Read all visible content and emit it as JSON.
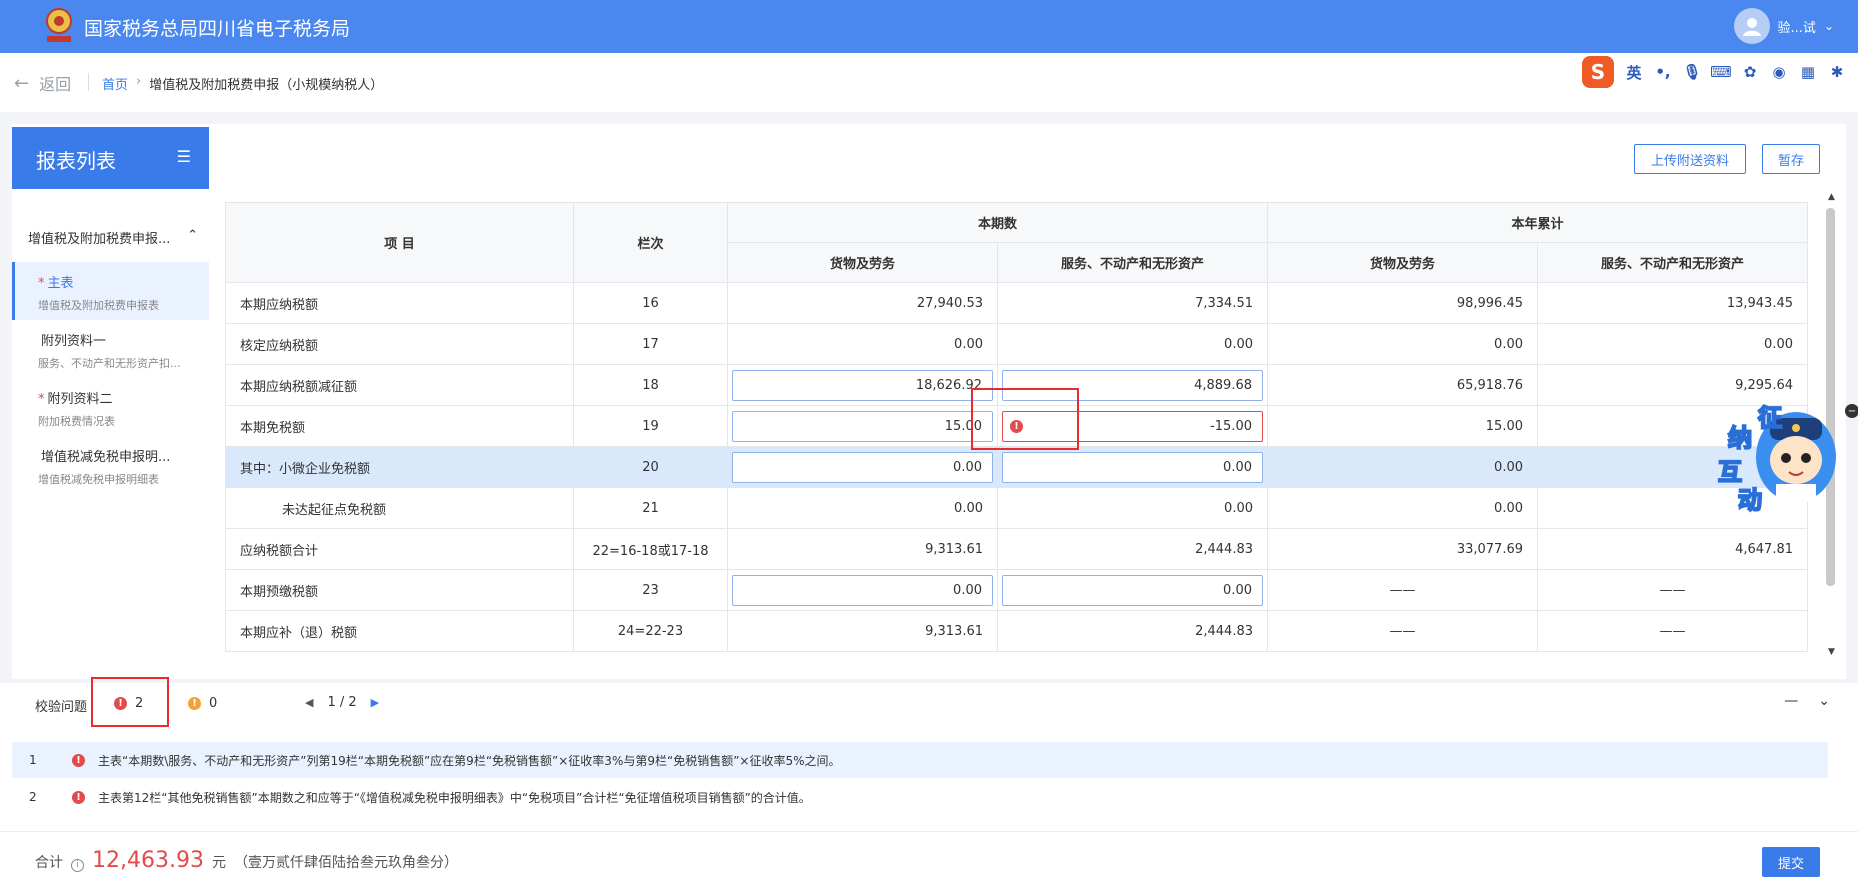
{
  "header": {
    "title": "国家税务总局四川省电子税务局",
    "user": "验...试"
  },
  "breadcrumb": {
    "back": "返回",
    "home": "首页",
    "sep": "›",
    "current": "增值税及附加税费申报（小规模纳税人）"
  },
  "ime": {
    "logo": "S",
    "lang": "英"
  },
  "sidebar": {
    "title": "报表列表",
    "group": "增值税及附加税费申报...",
    "items": [
      {
        "label": "主表",
        "sub": "增值税及附加税费申报表",
        "required": "*"
      },
      {
        "label": "附列资料一",
        "sub": "服务、不动产和无形资产扣...",
        "required": ""
      },
      {
        "label": "附列资料二",
        "sub": "附加税费情况表",
        "required": "*"
      },
      {
        "label": "增值税减免税申报明...",
        "sub": "增值税减免税申报明细表",
        "required": ""
      }
    ]
  },
  "actions": {
    "upload": "上传附送资料",
    "save": "暂存"
  },
  "table": {
    "h_item": "项  目",
    "h_col": "栏次",
    "h_current": "本期数",
    "h_ytd": "本年累计",
    "h_goods": "货物及劳务",
    "h_services": "服务、不动产和无形资产",
    "rows": [
      {
        "name": "本期应纳税额",
        "col": "16",
        "c1": "27,940.53",
        "c2": "7,334.51",
        "y1": "98,996.45",
        "y2": "13,943.45"
      },
      {
        "name": "核定应纳税额",
        "col": "17",
        "c1": "0.00",
        "c2": "0.00",
        "y1": "0.00",
        "y2": "0.00"
      },
      {
        "name": "本期应纳税额减征额",
        "col": "18",
        "c1": "18,626.92",
        "c2": "4,889.68",
        "y1": "65,918.76",
        "y2": "9,295.64"
      },
      {
        "name": "本期免税额",
        "col": "19",
        "c1": "15.00",
        "c2": "-15.00",
        "y1": "15.00",
        "y2": ""
      },
      {
        "name": "其中：小微企业免税额",
        "col": "20",
        "c1": "0.00",
        "c2": "0.00",
        "y1": "0.00",
        "y2": ""
      },
      {
        "name": "未达起征点免税额",
        "col": "21",
        "c1": "0.00",
        "c2": "0.00",
        "y1": "0.00",
        "y2": ""
      },
      {
        "name": "应纳税额合计",
        "col": "22=16-18或17-18",
        "c1": "9,313.61",
        "c2": "2,444.83",
        "y1": "33,077.69",
        "y2": "4,647.81"
      },
      {
        "name": "本期预缴税额",
        "col": "23",
        "c1": "0.00",
        "c2": "0.00",
        "y1": "——",
        "y2": "——"
      },
      {
        "name": "本期应补（退）税额",
        "col": "24=22-23",
        "c1": "9,313.61",
        "c2": "2,444.83",
        "y1": "——",
        "y2": "——"
      }
    ]
  },
  "mascot": {
    "t1": "征",
    "t2": "纳",
    "t3": "互",
    "t4": "动"
  },
  "validation": {
    "label": "校验问题",
    "errors": "2",
    "warnings": "0",
    "page": "1 / 2",
    "issues": [
      {
        "idx": "1",
        "text": "主表“本期数\\服务、不动产和无形资产”列第19栏“本期免税额”应在第9栏“免税销售额”×征收率3%与第9栏“免税销售额”×征收率5%之间。"
      },
      {
        "idx": "2",
        "text": "主表第12栏“其他免税销售额”本期数之和应等于“《增值税减免税申报明细表》中“免税项目”合计栏“免征增值税项目销售额”的合计值。"
      }
    ]
  },
  "footer": {
    "total_label": "合计",
    "amount": "12,463.93",
    "unit": "元",
    "words": "（壹万贰仟肆佰陆拾叁元玖角叁分）",
    "submit": "提交"
  },
  "colors": {
    "brand": "#4a87ee",
    "primary": "#3a7bea",
    "error": "#e24b4b",
    "warning": "#f3a03a"
  }
}
